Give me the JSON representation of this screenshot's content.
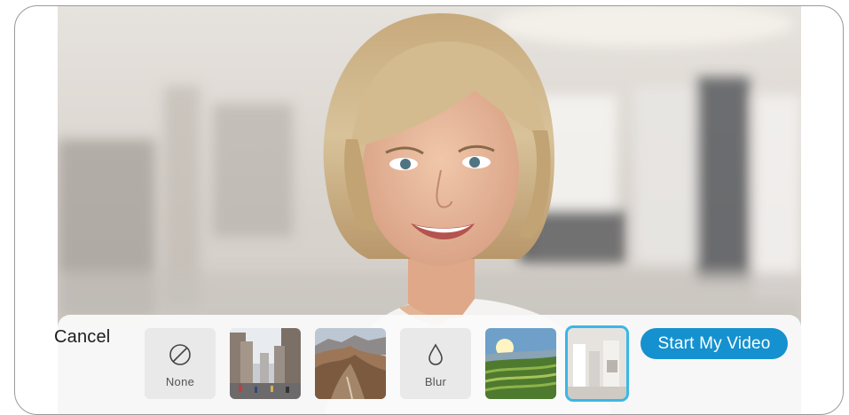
{
  "video": {
    "subject": "person-smiling",
    "background": "blurred-office"
  },
  "tray": {
    "cancel_label": "Cancel",
    "start_label": "Start My Video",
    "accent_color": "#1591cf",
    "selected_border_color": "#3bb7e5",
    "backgrounds": [
      {
        "label": "None",
        "icon": "no-symbol-icon",
        "kind": "option"
      },
      {
        "label": "",
        "icon": "city-street-thumbnail",
        "kind": "image"
      },
      {
        "label": "",
        "icon": "mountain-ridge-thumbnail",
        "kind": "image"
      },
      {
        "label": "Blur",
        "icon": "droplet-icon",
        "kind": "option"
      },
      {
        "label": "",
        "icon": "rice-terraces-thumbnail",
        "kind": "image"
      },
      {
        "label": "",
        "icon": "office-thumbnail",
        "kind": "image",
        "selected": true
      }
    ]
  }
}
